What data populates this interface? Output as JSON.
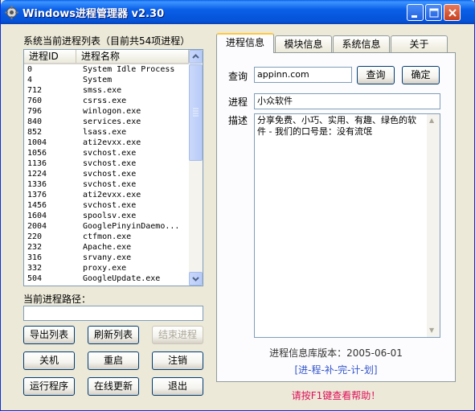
{
  "window": {
    "title": "Windows进程管理器 v2.30"
  },
  "left": {
    "list_title": "系统当前进程列表（目前共54项进程）",
    "columns": [
      "进程ID",
      "进程名称"
    ],
    "processes": [
      {
        "id": "0",
        "name": "System Idle Process"
      },
      {
        "id": "4",
        "name": "System"
      },
      {
        "id": "712",
        "name": "smss.exe"
      },
      {
        "id": "760",
        "name": "csrss.exe"
      },
      {
        "id": "796",
        "name": "winlogon.exe"
      },
      {
        "id": "840",
        "name": "services.exe"
      },
      {
        "id": "852",
        "name": "lsass.exe"
      },
      {
        "id": "1004",
        "name": "ati2evxx.exe"
      },
      {
        "id": "1056",
        "name": "svchost.exe"
      },
      {
        "id": "1136",
        "name": "svchost.exe"
      },
      {
        "id": "1224",
        "name": "svchost.exe"
      },
      {
        "id": "1336",
        "name": "svchost.exe"
      },
      {
        "id": "1376",
        "name": "ati2evxx.exe"
      },
      {
        "id": "1456",
        "name": "svchost.exe"
      },
      {
        "id": "1604",
        "name": "spoolsv.exe"
      },
      {
        "id": "2004",
        "name": "GooglePinyinDaemo..."
      },
      {
        "id": "220",
        "name": "ctfmon.exe"
      },
      {
        "id": "232",
        "name": "Apache.exe"
      },
      {
        "id": "316",
        "name": "srvany.exe"
      },
      {
        "id": "332",
        "name": "proxy.exe"
      },
      {
        "id": "504",
        "name": "GoogleUpdate.exe"
      }
    ],
    "path_label": "当前进程路径：",
    "path_value": "",
    "buttons": {
      "export": "导出列表",
      "refresh": "刷新列表",
      "end": "结束进程",
      "shutdown": "关机",
      "restart": "重启",
      "logoff": "注销",
      "run": "运行程序",
      "update": "在线更新",
      "exit": "退出"
    }
  },
  "tabs": [
    "进程信息",
    "模块信息",
    "系统信息",
    "关于"
  ],
  "info": {
    "query_label": "查询",
    "query_value": "appinn.com",
    "query_button": "查询",
    "ok_button": "确定",
    "process_label": "进程",
    "process_value": "小众软件",
    "desc_label": "描述",
    "desc_value": "分享免费、小巧、实用、有趣、绿色的软件 - 我们的口号是：没有流氓",
    "db_version": "进程信息库版本：2005-06-01",
    "supplement_link": "[进-程-补-完-计-划]",
    "help_text": "请按F1键查看帮助！"
  }
}
